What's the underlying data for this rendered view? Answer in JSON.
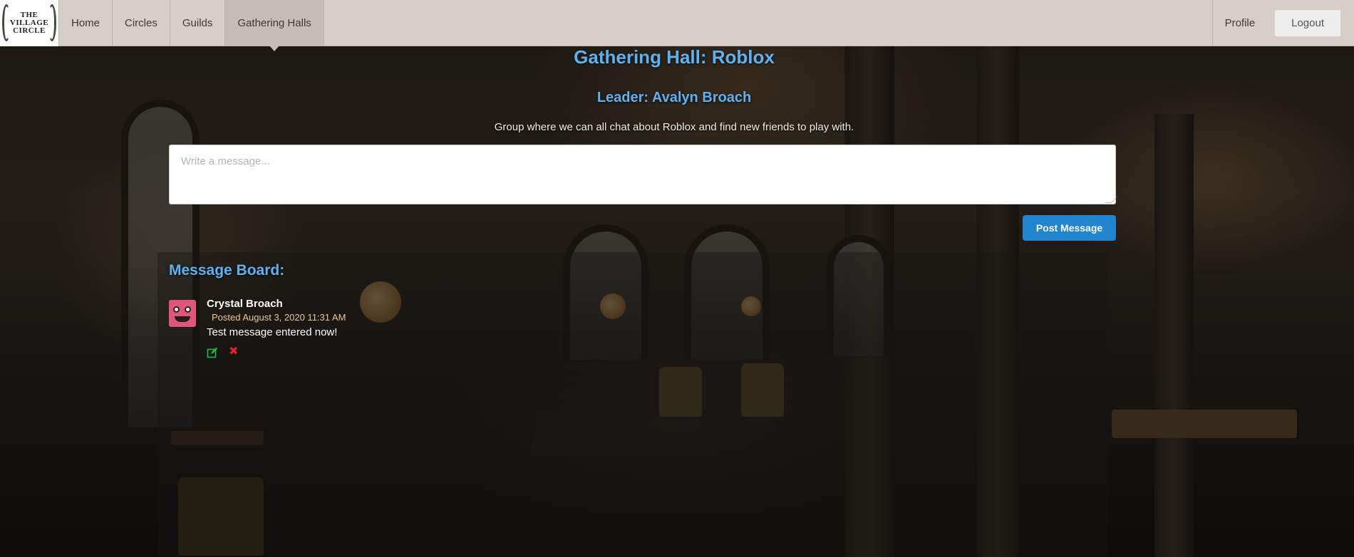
{
  "nav": {
    "logo_text": "THE VILLAGE CIRCLE",
    "logo_line1": "THE",
    "logo_line2": "VILLAGE",
    "logo_line3": "CIRCLE",
    "items": [
      {
        "label": "Home"
      },
      {
        "label": "Circles"
      },
      {
        "label": "Guilds"
      },
      {
        "label": "Gathering Halls",
        "active": true
      }
    ],
    "profile_label": "Profile",
    "logout_label": "Logout"
  },
  "hall": {
    "title": "Gathering Hall: Roblox",
    "leader": "Leader: Avalyn Broach",
    "description": "Group where we can all chat about Roblox and find new friends to play with."
  },
  "composer": {
    "placeholder": "Write a message...",
    "value": "",
    "post_label": "Post Message"
  },
  "board": {
    "title": "Message Board:",
    "messages": [
      {
        "author": "Crystal Broach",
        "posted": "Posted August 3, 2020 11:31 AM",
        "text": "Test message entered now!",
        "avatar_icon": "robot-avatar-icon",
        "actions": [
          "edit-icon",
          "delete-icon"
        ]
      }
    ]
  },
  "colors": {
    "heading_blue": "#5fb1f2",
    "button_blue": "#2185d0",
    "nav_bg": "#d7cdca",
    "date_gold": "#e9c98f",
    "delete_red": "#e0202a",
    "edit_green": "#21ba45"
  }
}
